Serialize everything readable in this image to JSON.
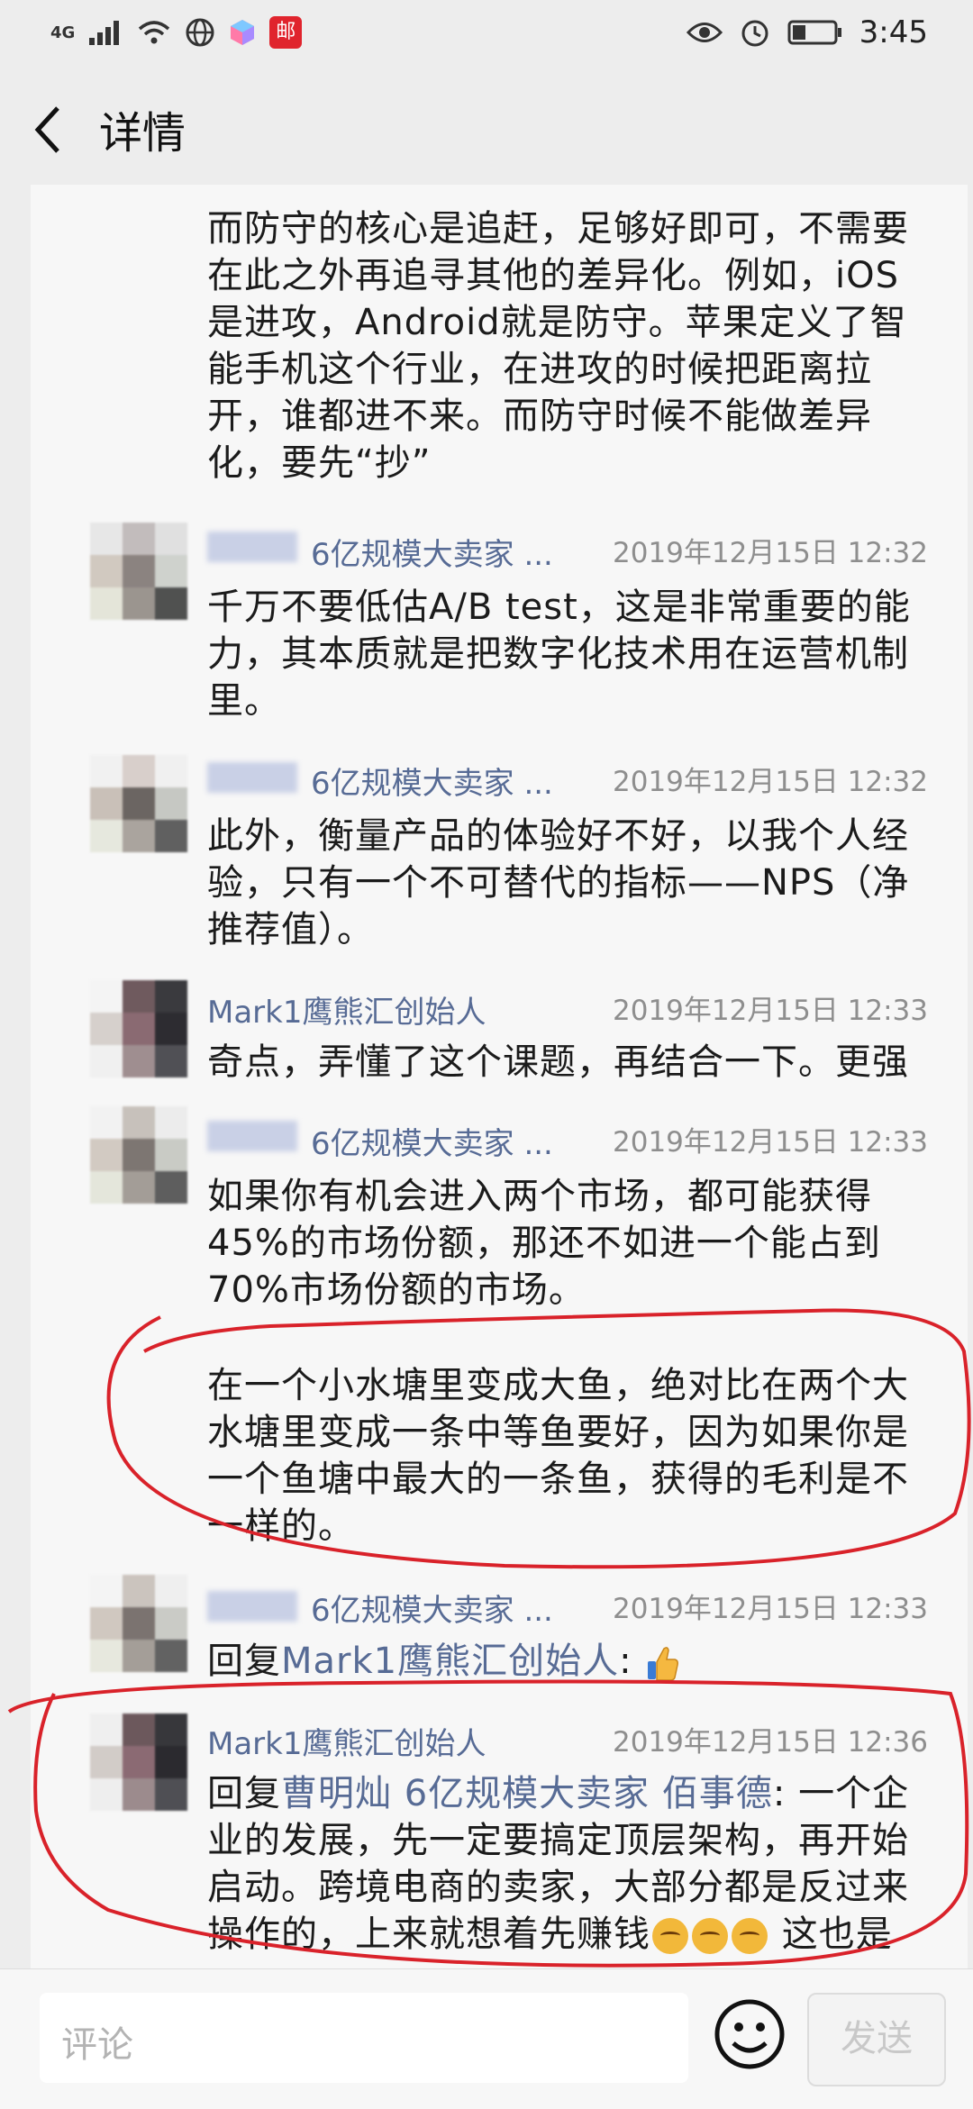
{
  "status_bar": {
    "network": "4G",
    "time": "3:45",
    "app_badge": "邮"
  },
  "nav": {
    "title": "详情"
  },
  "comments": [
    {
      "text": "而防守的核心是追赶，足够好即可，不需要在此之外再追寻其他的差异化。例如，iOS是进攻，Android就是防守。苹果定义了智能手机这个行业，在进攻的时候把距离拉开，谁都进不来。而防守时候不能做差异化，要先“抄”"
    },
    {
      "name": "6亿规模大卖家 ...",
      "time": "2019年12月15日 12:32",
      "text": "千万不要低估A/B test，这是非常重要的能力，其本质就是把数字化技术用在运营机制里。"
    },
    {
      "name": "6亿规模大卖家 ...",
      "time": "2019年12月15日 12:32",
      "text": "此外，衡量产品的体验好不好，以我个人经验，只有一个不可替代的指标——NPS（净推荐值）。"
    },
    {
      "name": "Mark1鹰熊汇创始人",
      "time": "2019年12月15日 12:33",
      "text": "奇点，弄懂了这个课题，再结合一下。更强"
    },
    {
      "name": "6亿规模大卖家 ...",
      "time": "2019年12月15日 12:33",
      "text": "如果你有机会进入两个市场，都可能获得45%的市场份额，那还不如进一个能占到70%市场份额的市场。"
    },
    {
      "text": "在一个小水塘里变成大鱼，绝对比在两个大水塘里变成一条中等鱼要好，因为如果你是一个鱼塘中最大的一条鱼，获得的毛利是不一样的。"
    },
    {
      "name": "6亿规模大卖家 ...",
      "time": "2019年12月15日 12:33",
      "reply_prefix": "回复",
      "reply_to": "Mark1鹰熊汇创始人",
      "colon": ":"
    },
    {
      "name": "Mark1鹰熊汇创始人",
      "time": "2019年12月15日 12:36",
      "reply_prefix": "回复",
      "reply_to": "曹明灿 6亿规模大卖家 佰事德",
      "colon": ":",
      "text_a": " 一个企业的发展，先一定要搞定顶层架构，再开始启动。跨境电商的卖家，大部分都是反过来操作的，上来就想着先赚钱",
      "text_b": " 这也是"
    }
  ],
  "input_bar": {
    "placeholder": "评论",
    "send_label": "发送"
  },
  "colors": {
    "link": "#576b95",
    "annotation": "#d9222a",
    "background": "#ededed",
    "panel": "#f7f7f7"
  },
  "icons": [
    "signal-icon",
    "wifi-icon",
    "globe-icon",
    "eye-icon",
    "alarm-icon",
    "battery-icon",
    "back-chevron-icon",
    "smiley-icon",
    "thumbs-up-icon",
    "thinking-emoji-icon"
  ]
}
